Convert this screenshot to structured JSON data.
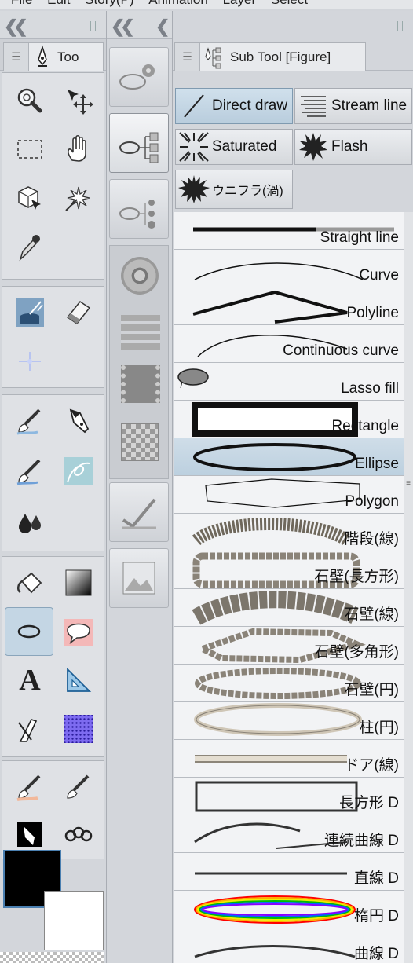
{
  "menu": [
    "File",
    "Edit",
    "Story(P)",
    "Animation",
    "Layer",
    "Select"
  ],
  "tool_panel": {
    "tab_label": "Too"
  },
  "sub_tool_panel": {
    "tab_label": "Sub Tool [Figure]"
  },
  "sub_tools": [
    {
      "label": "Direct draw",
      "icon": "direct-draw-icon",
      "active": true
    },
    {
      "label": "Stream line",
      "icon": "stream-line-icon",
      "active": false
    },
    {
      "label": "Saturated",
      "icon": "saturated-icon",
      "active": false
    },
    {
      "label": "Flash",
      "icon": "flash-icon",
      "active": false
    },
    {
      "label": "ウニフラ(渦)",
      "icon": "uniflash-icon",
      "active": false
    }
  ],
  "figure_list": [
    {
      "label": "Straight line"
    },
    {
      "label": "Curve"
    },
    {
      "label": "Polyline"
    },
    {
      "label": "Continuous curve"
    },
    {
      "label": "Lasso fill"
    },
    {
      "label": "Rectangle"
    },
    {
      "label": "Ellipse",
      "selected": true
    },
    {
      "label": "Polygon"
    },
    {
      "label": "階段(線)"
    },
    {
      "label": "石壁(長方形)"
    },
    {
      "label": "石壁(線)"
    },
    {
      "label": "石壁(多角形)"
    },
    {
      "label": "石壁(円)"
    },
    {
      "label": "柱(円)"
    },
    {
      "label": "ドア(線)"
    },
    {
      "label": "長方形 D"
    },
    {
      "label": "連続曲線 D"
    },
    {
      "label": "直線 D"
    },
    {
      "label": "楕円 D"
    },
    {
      "label": "曲線 D"
    }
  ],
  "colors": {
    "accent": "#c4d6e4",
    "main_color": "#000000"
  }
}
